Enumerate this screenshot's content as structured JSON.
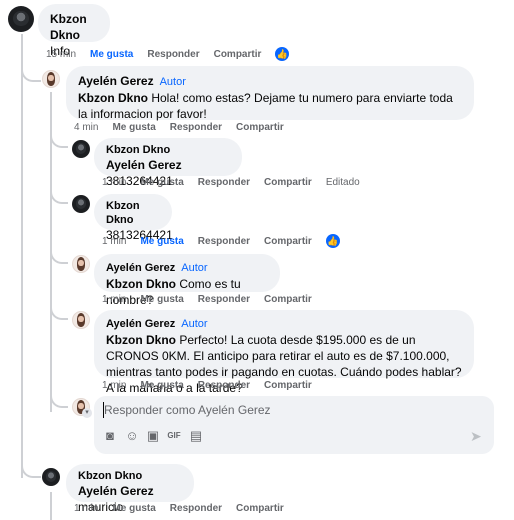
{
  "comment": {
    "author": "Kbzon Dkno",
    "text": "Info",
    "time": "15 min",
    "like": "Me gusta",
    "reply": "Responder",
    "share": "Compartir"
  },
  "replies": [
    {
      "author": "Ayelén Gerez",
      "badge": "Autor",
      "tag": "Kbzon Dkno",
      "text": " Hola! como estas? Dejame tu numero para enviarte toda la informacion por favor!",
      "time": "4 min",
      "like": "Me gusta",
      "reply": "Responder",
      "share": "Compartir"
    },
    {
      "author": "Kbzon Dkno",
      "tag": "Ayelén Gerez",
      "text": " 3813264421",
      "time": "1 min",
      "like": "Me gusta",
      "reply": "Responder",
      "share": "Compartir",
      "edited": "Editado"
    },
    {
      "author": "Kbzon Dkno",
      "tag": "",
      "text": "3813264421",
      "time": "1 min",
      "like": "Me gusta",
      "reply": "Responder",
      "share": "Compartir"
    },
    {
      "author": "Ayelén Gerez",
      "badge": "Autor",
      "tag": "Kbzon Dkno",
      "text": " Como es tu nombre?",
      "time": "1 min",
      "like": "Me gusta",
      "reply": "Responder",
      "share": "Compartir"
    },
    {
      "author": "Ayelén Gerez",
      "badge": "Autor",
      "tag": "Kbzon Dkno",
      "text": " Perfecto! La cuota desde $195.000 es de un CRONOS 0KM. El anticipo para retirar el auto es de $7.100.000, mientras tanto podes ir pagando en cuotas. Cuándo podes hablar? A la mañana o a la tarde?",
      "time": "1 min",
      "like": "Me gusta",
      "reply": "Responder",
      "share": "Compartir"
    },
    {
      "author": "Kbzon Dkno",
      "tag": "Ayelén Gerez",
      "text": " mauricio",
      "time": "1 min",
      "like": "Me gusta",
      "reply": "Responder",
      "share": "Compartir"
    }
  ],
  "reply_box": {
    "placeholder": "Responder como Ayelén Gerez",
    "tools": [
      "sticker-icon",
      "emoji-icon",
      "camera-icon",
      "gif-icon",
      "avatar-sticker-icon"
    ],
    "send": "send-icon"
  },
  "colors": {
    "link": "#0866ff",
    "bubble": "#f0f2f5",
    "meta": "#65676b"
  }
}
